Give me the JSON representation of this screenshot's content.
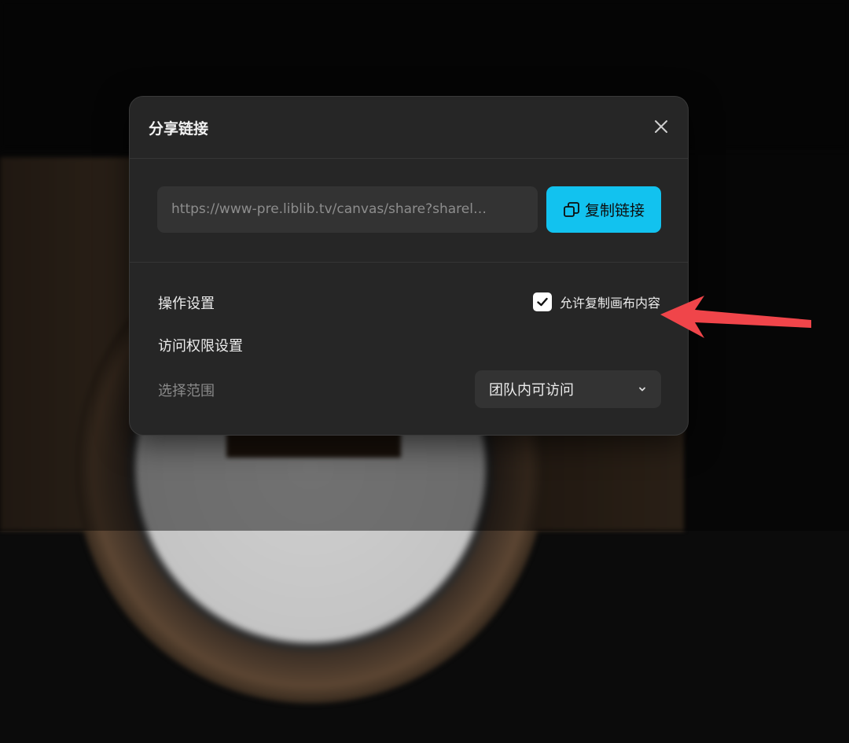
{
  "dialog": {
    "title": "分享链接",
    "share_url": "https://www-pre.liblib.tv/canvas/share?sharel…",
    "copy_button_label": "复制链接",
    "operation_settings_label": "操作设置",
    "allow_copy_label": "允许复制画布内容",
    "allow_copy_checked": true,
    "access_settings_label": "访问权限设置",
    "scope_label": "选择范围",
    "scope_value": "团队内可访问"
  },
  "colors": {
    "accent": "#12c2ef",
    "annotation_arrow": "#f0454a",
    "dialog_bg": "#262626"
  },
  "icons": {
    "close": "close-icon",
    "copy": "copy-icon",
    "check": "check-icon",
    "chevron": "chevron-down-icon"
  }
}
